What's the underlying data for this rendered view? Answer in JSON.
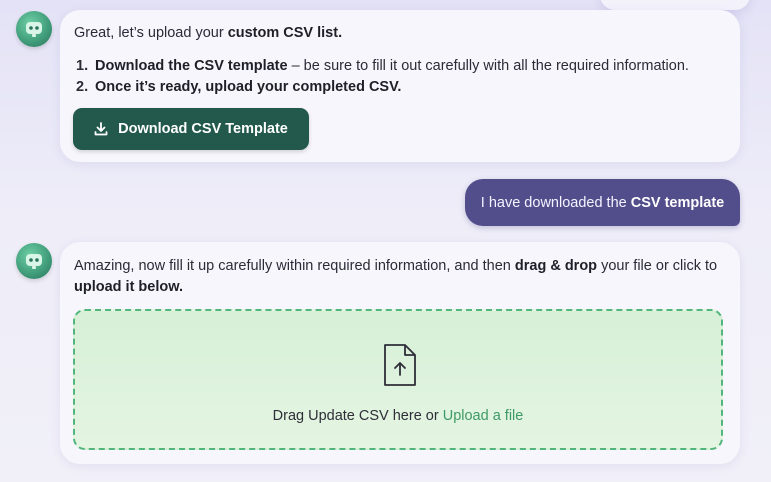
{
  "messages": {
    "bot1": {
      "intro_prefix": "Great, let’s upload your ",
      "intro_bold": "custom CSV list.",
      "steps": [
        {
          "num": "1.",
          "bold": "Download the CSV template",
          "rest": " – be sure to fill it out carefully with all the required information."
        },
        {
          "num": "2.",
          "bold": "Once it’s ready, upload your completed CSV.",
          "rest": ""
        }
      ],
      "button_label": "Download CSV Template",
      "button_icon": "download-icon"
    },
    "user1": {
      "prefix": "I have downloaded the ",
      "bold": "CSV template"
    },
    "bot2": {
      "line_prefix": "Amazing, now fill it up carefully within required information, and then ",
      "line_bold": "drag & drop",
      "line_mid": " your file or click to ",
      "line_bold2": "upload it below.",
      "dropzone": {
        "icon": "file-upload-icon",
        "text": "Drag Update CSV here or ",
        "link": "Upload a file"
      }
    }
  },
  "colors": {
    "primary_button": "#23594c",
    "user_bubble": "#524e8c",
    "dropzone_border": "#52b57b",
    "link": "#3e9a66"
  }
}
